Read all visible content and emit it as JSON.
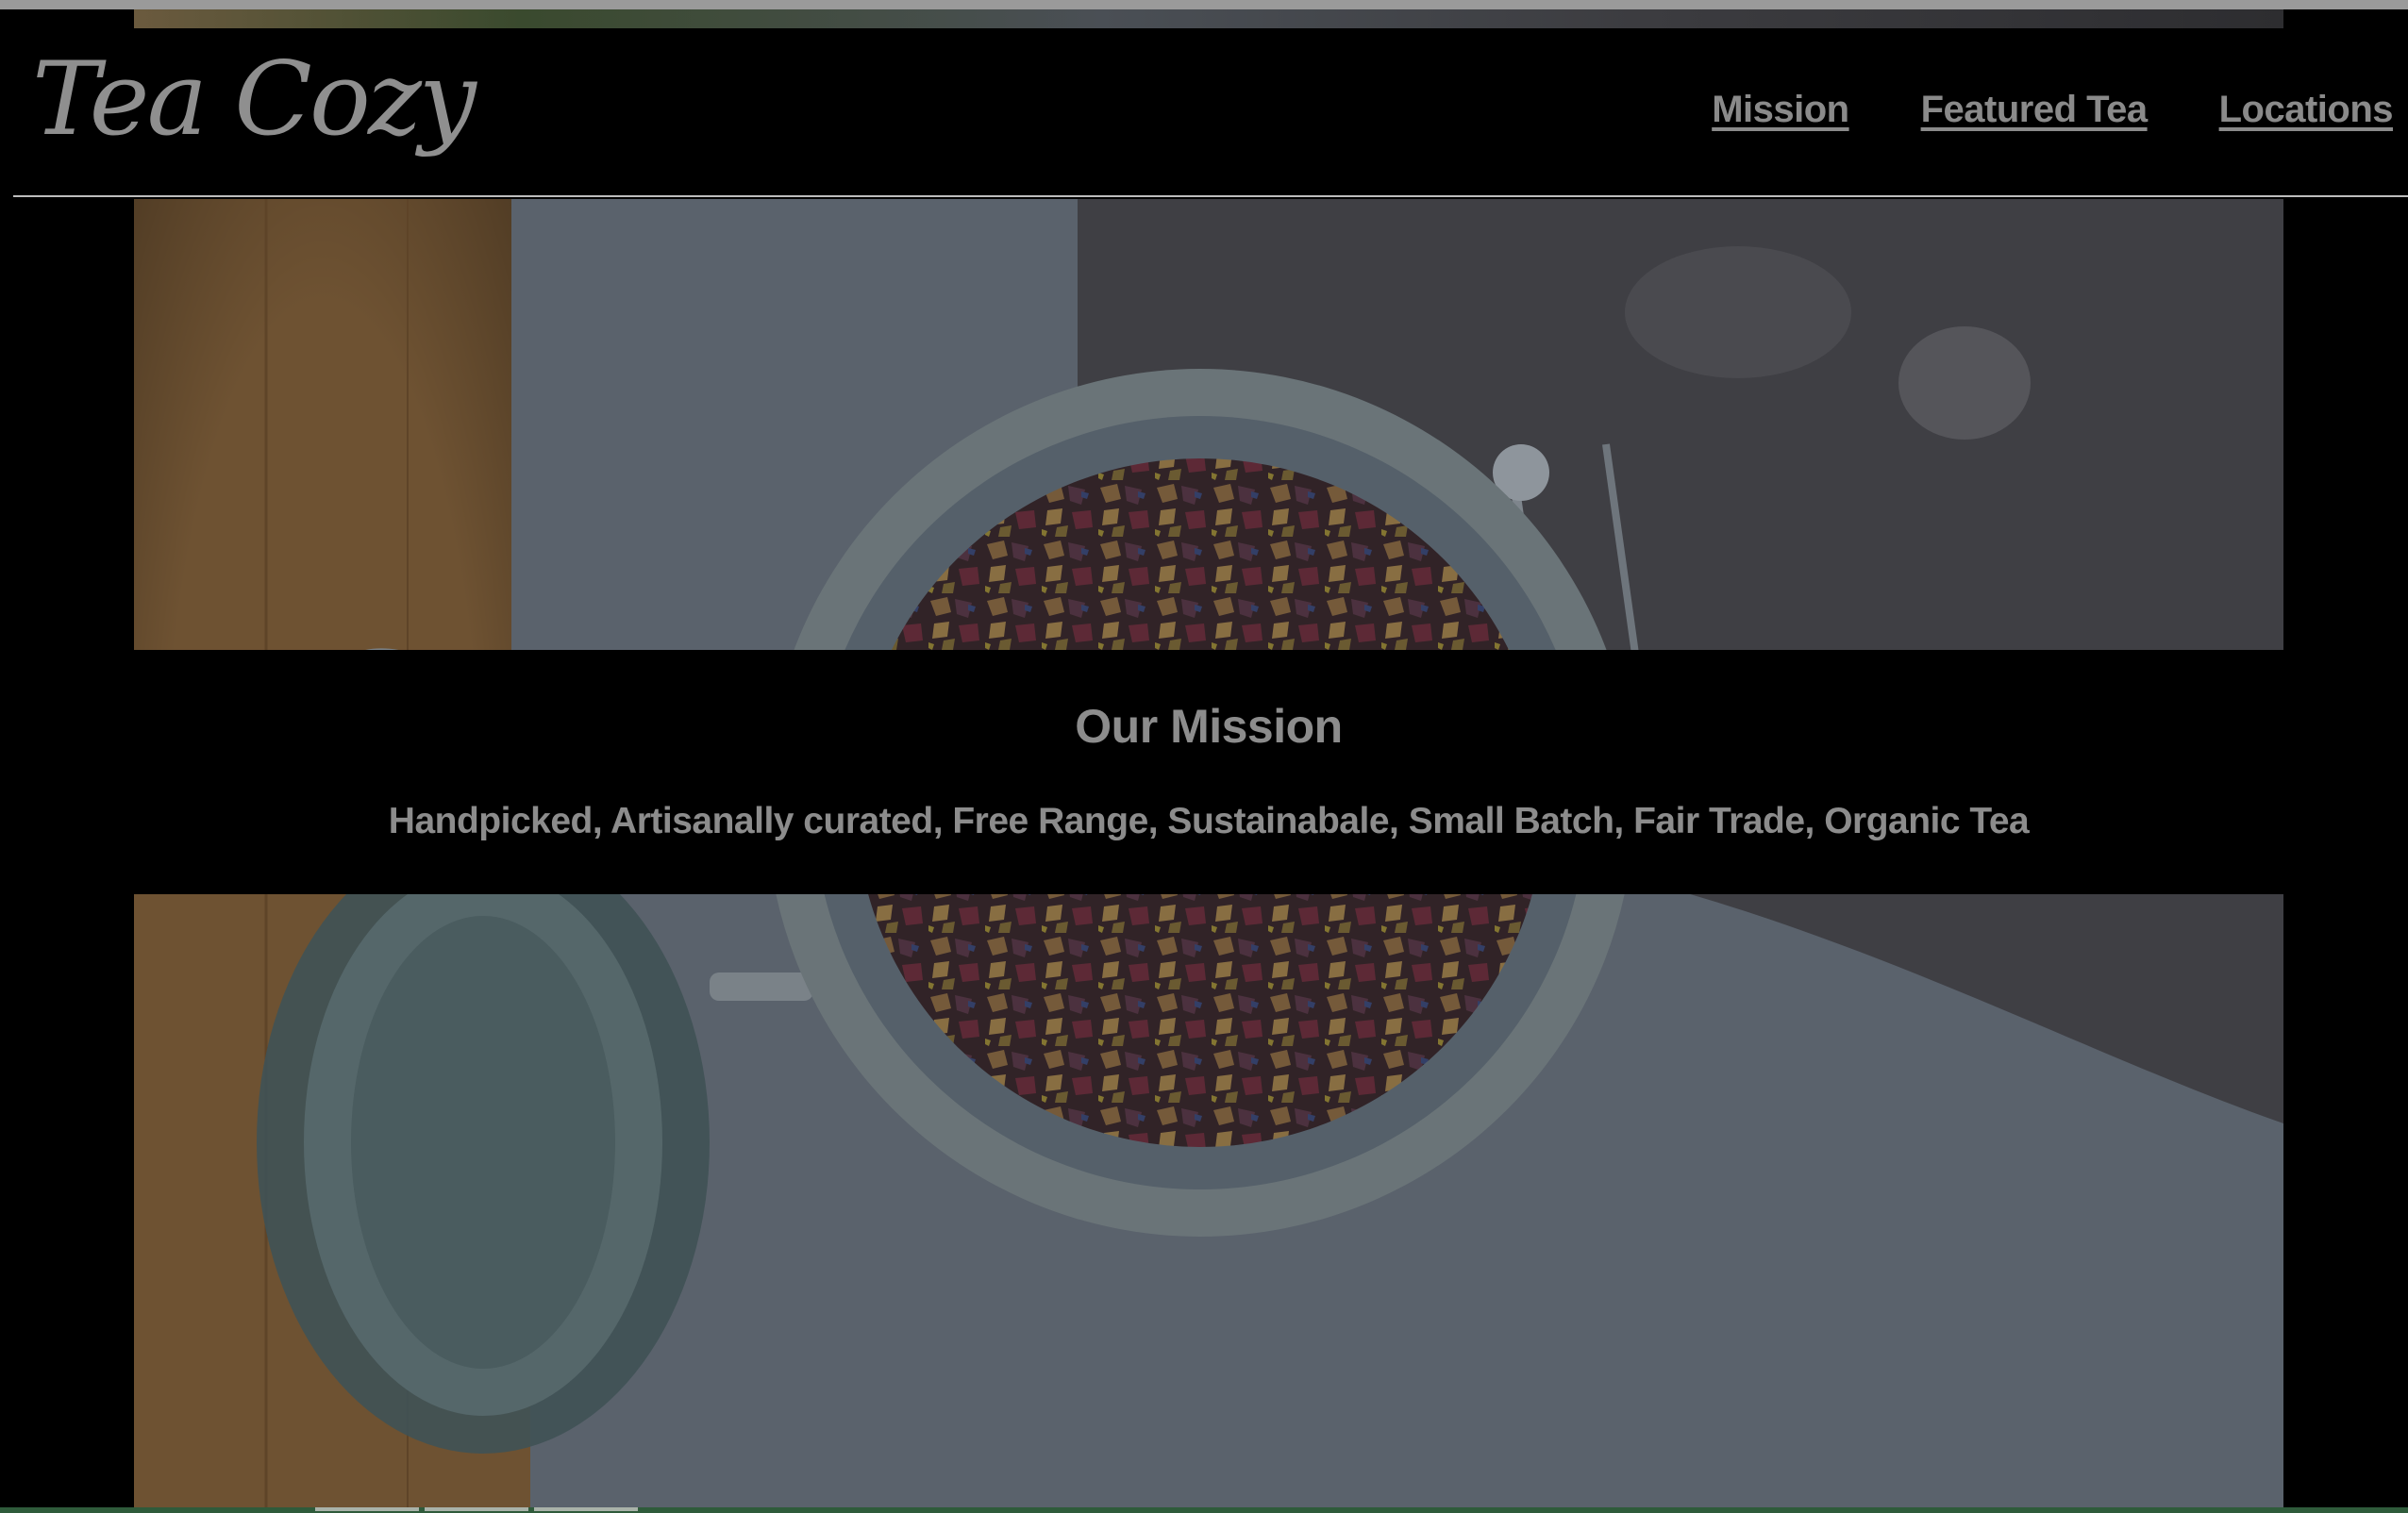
{
  "site": {
    "logo_text": "Tea Cozy"
  },
  "nav": {
    "items": [
      {
        "label": "Mission"
      },
      {
        "label": "Featured Tea"
      },
      {
        "label": "Locations"
      }
    ]
  },
  "mission": {
    "heading": "Our Mission",
    "tagline": "Handpicked, Artisanally curated, Free Range, Sustainabale, Small Batch, Fair Trade, Organic Tea"
  },
  "colors": {
    "background": "#000000",
    "text_gray": "#8c8c8c",
    "header_rule": "#bdbdbd"
  },
  "icons": {
    "hero_image": "tea-jar-photo"
  }
}
